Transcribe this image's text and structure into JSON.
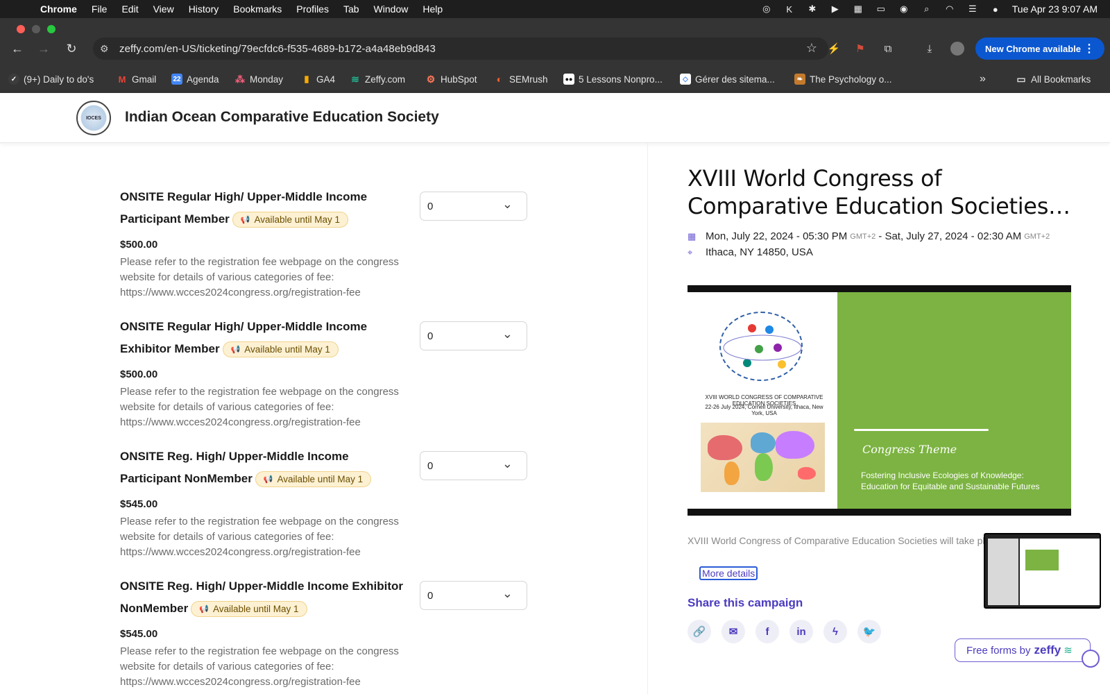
{
  "menubar": {
    "app": "Chrome",
    "items": [
      "File",
      "Edit",
      "View",
      "History",
      "Bookmarks",
      "Profiles",
      "Tab",
      "Window",
      "Help"
    ],
    "datetime": "Tue Apr 23  9:07 AM"
  },
  "browser": {
    "url": "zeffy.com/en-US/ticketing/79ecfdc6-f535-4689-b172-a4a48eb9d843",
    "new_chrome_label": "New Chrome available",
    "all_bookmarks_label": "All Bookmarks",
    "bookmarks": [
      {
        "label": "(9+) Daily to do's",
        "icon": "check-icon",
        "color": "#3c3c3c"
      },
      {
        "label": "Gmail",
        "icon": "gmail-icon",
        "color": "#ea4335"
      },
      {
        "label": "Agenda",
        "icon": "calendar-icon",
        "color": "#4285f4"
      },
      {
        "label": "Monday",
        "icon": "monday-icon",
        "color": "#f65f7c"
      },
      {
        "label": "GA4",
        "icon": "analytics-icon",
        "color": "#f9ab00"
      },
      {
        "label": "Zeffy.com",
        "icon": "zeffy-icon",
        "color": "#21b28f"
      },
      {
        "label": "HubSpot",
        "icon": "hubspot-icon",
        "color": "#ff7a59"
      },
      {
        "label": "SEMrush",
        "icon": "semrush-icon",
        "color": "#ff642d"
      },
      {
        "label": "5 Lessons Nonpro...",
        "icon": "medium-icon",
        "color": "#000000"
      },
      {
        "label": "Gérer des sitema...",
        "icon": "search-console-icon",
        "color": "#ffffff"
      },
      {
        "label": "The Psychology o...",
        "icon": "book-icon",
        "color": "#c47a2c"
      }
    ]
  },
  "header": {
    "org_name": "Indian Ocean Comparative Education Society",
    "logo_text": "IOCES"
  },
  "tickets": [
    {
      "title": "ONSITE Regular High/ Upper-Middle Income Participant Member",
      "badge": "Available until May 1",
      "price": "$500.00",
      "description": "Please refer to the registration fee webpage on the congress website for details of various categories of fee: https://www.wcces2024congress.org/registration-fee",
      "quantity": "0"
    },
    {
      "title": "ONSITE Regular High/ Upper-Middle Income Exhibitor Member",
      "badge": "Available until May 1",
      "price": "$500.00",
      "description": "Please refer to the registration fee webpage on the congress website for details of various categories of fee: https://www.wcces2024congress.org/registration-fee",
      "quantity": "0"
    },
    {
      "title": "ONSITE Reg. High/ Upper-Middle Income Participant NonMember",
      "badge": "Available until May 1",
      "price": "$545.00",
      "description": "Please refer to the registration fee webpage on the congress website for details of various categories of fee: https://www.wcces2024congress.org/registration-fee",
      "quantity": "0"
    },
    {
      "title": "ONSITE Reg. High/ Upper-Middle Income Exhibitor NonMember",
      "badge": "Available until May 1",
      "price": "$545.00",
      "description": "Please refer to the registration fee webpage on the congress website for details of various categories of fee: https://www.wcces2024congress.org/registration-fee",
      "quantity": "0"
    }
  ],
  "event": {
    "title": "XVIII World Congress of Comparative Education Societies…",
    "start": "Mon, July 22, 2024 - 05:30 PM",
    "end": "Sat, July 27, 2024 - 02:30 AM",
    "tz": "GMT+2",
    "location": "Ithaca, NY 14850, USA",
    "banner": {
      "caption1": "XVIII WORLD CONGRESS OF COMPARATIVE EDUCATION SOCIETIES",
      "caption2": "22-26 July 2024, Cornell University, Ithaca, New York, USA",
      "theme_label": "Congress Theme",
      "theme_text": "Fostering Inclusive Ecologies of Knowledge: Education for Equitable and Sustainable Futures"
    },
    "intro": "XVIII World Congress of Comparative Education Societies will take place from",
    "more_details": "More details",
    "share_title": "Share this campaign",
    "share_icons": [
      "link-icon",
      "email-icon",
      "facebook-icon",
      "linkedin-icon",
      "messenger-icon",
      "twitter-icon"
    ]
  },
  "footer": {
    "free_forms": "Free forms by",
    "brand": "zeffy"
  },
  "colors": {
    "accent": "#4b3bbf",
    "badge_bg": "#fdf1d3",
    "banner_green": "#7cb342",
    "chrome_blue": "#0b57d0"
  }
}
